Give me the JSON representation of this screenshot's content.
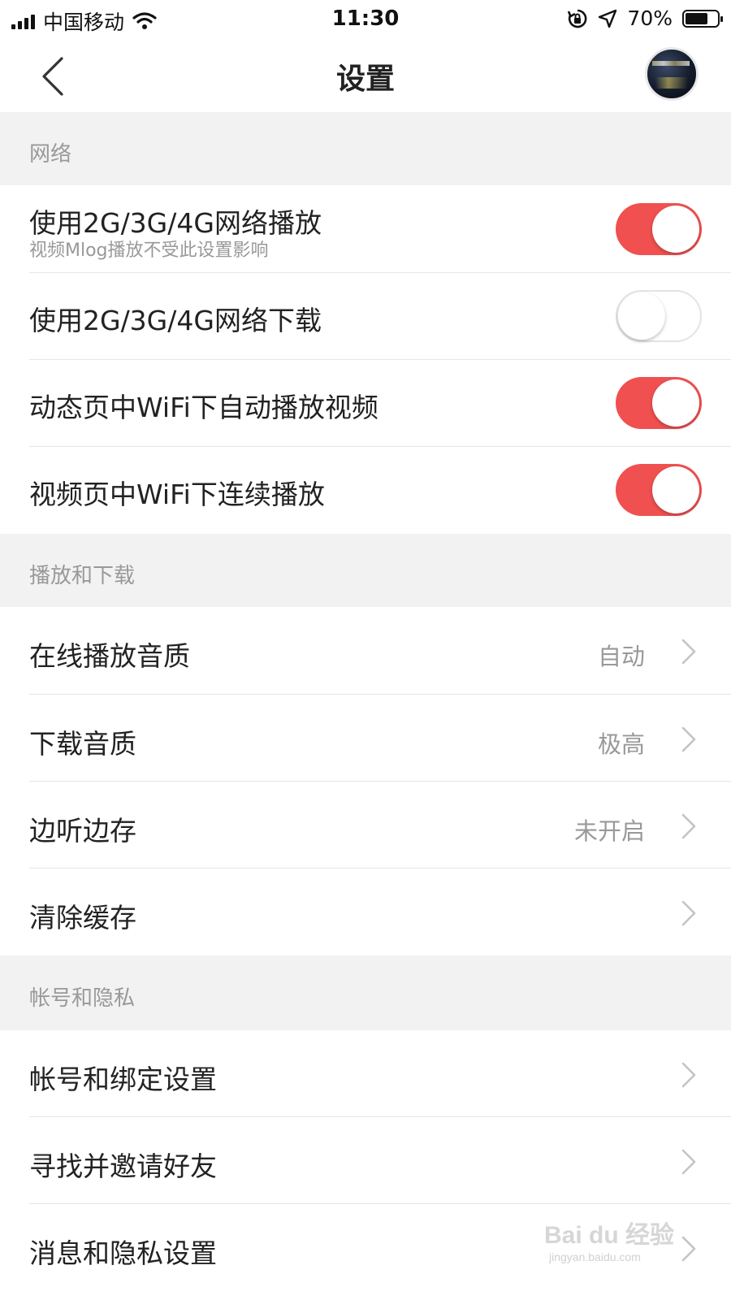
{
  "status_bar": {
    "carrier": "中国移动",
    "time": "11:30",
    "battery": "70%",
    "battery_level": 0.7
  },
  "nav": {
    "title": "设置"
  },
  "sections": {
    "network": {
      "header": "网络",
      "items": [
        {
          "label": "使用2G/3G/4G网络播放",
          "sublabel": "视频Mlog播放不受此设置影响",
          "toggle": true
        },
        {
          "label": "使用2G/3G/4G网络下载",
          "toggle": false
        },
        {
          "label": "动态页中WiFi下自动播放视频",
          "toggle": true
        },
        {
          "label": "视频页中WiFi下连续播放",
          "toggle": true
        }
      ]
    },
    "playback": {
      "header": "播放和下载",
      "items": [
        {
          "label": "在线播放音质",
          "value": "自动"
        },
        {
          "label": "下载音质",
          "value": "极高"
        },
        {
          "label": "边听边存",
          "value": "未开启"
        },
        {
          "label": "清除缓存",
          "value": ""
        }
      ]
    },
    "account": {
      "header": "帐号和隐私",
      "items": [
        {
          "label": "帐号和绑定设置"
        },
        {
          "label": "寻找并邀请好友"
        },
        {
          "label": "消息和隐私设置"
        }
      ]
    }
  },
  "colors": {
    "accent": "#f05050",
    "section_bg": "#f2f2f2",
    "secondary_text": "#999999"
  },
  "watermark": {
    "brand": "Bai du 经验",
    "url": "jingyan.baidu.com"
  }
}
